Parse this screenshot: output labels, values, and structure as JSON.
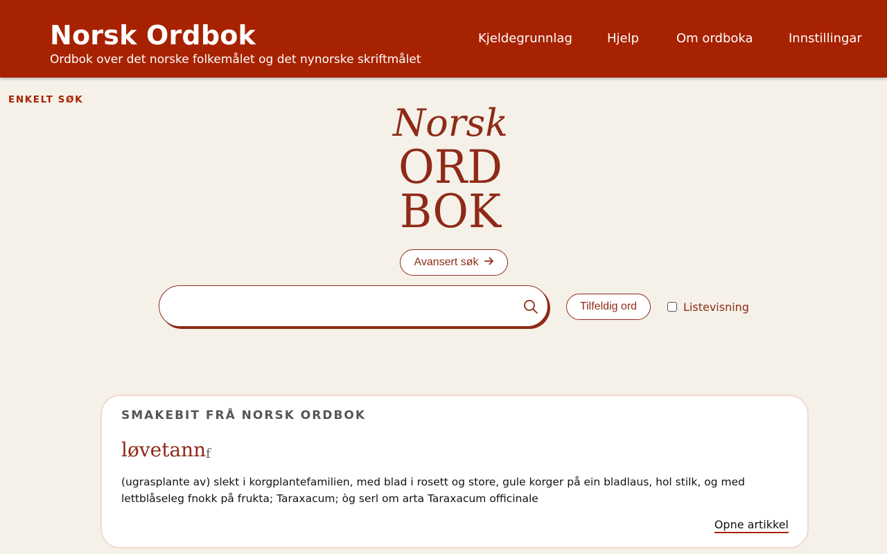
{
  "header": {
    "title": "Norsk Ordbok",
    "subtitle": "Ordbok over det norske folkemålet og det nynorske skriftmålet",
    "nav": [
      {
        "label": "Kjeldegrunnlag"
      },
      {
        "label": "Hjelp"
      },
      {
        "label": "Om ordboka"
      },
      {
        "label": "Innstillingar"
      }
    ],
    "color": "#a72200"
  },
  "search_mode": {
    "label": "ENKELT SØK"
  },
  "logo": {
    "line1": "Norsk",
    "line2": "ORD",
    "line3": "BOK",
    "color": "#8e2a17"
  },
  "advanced_search": {
    "label": "Avansert søk",
    "icon": "arrow-right-icon"
  },
  "search": {
    "value": "",
    "placeholder": "",
    "icon": "search-icon"
  },
  "random_word": {
    "label": "Tilfeldig ord"
  },
  "list_view": {
    "label": "Listevisning",
    "checked": false
  },
  "sample": {
    "heading": "SMAKEBIT FRÅ NORSK ORDBOK",
    "headword": "løvetann",
    "gender": "f",
    "definition": "(ugrasplante av) slekt i korgplantefamilien, med blad i rosett og store, gule korger på ein bladlaus, hol stilk, og med lettblåseleg fnokk på frukta; Taraxacum; òg serl om arta Taraxacum officinale",
    "open_link": "Opne artikkel"
  }
}
